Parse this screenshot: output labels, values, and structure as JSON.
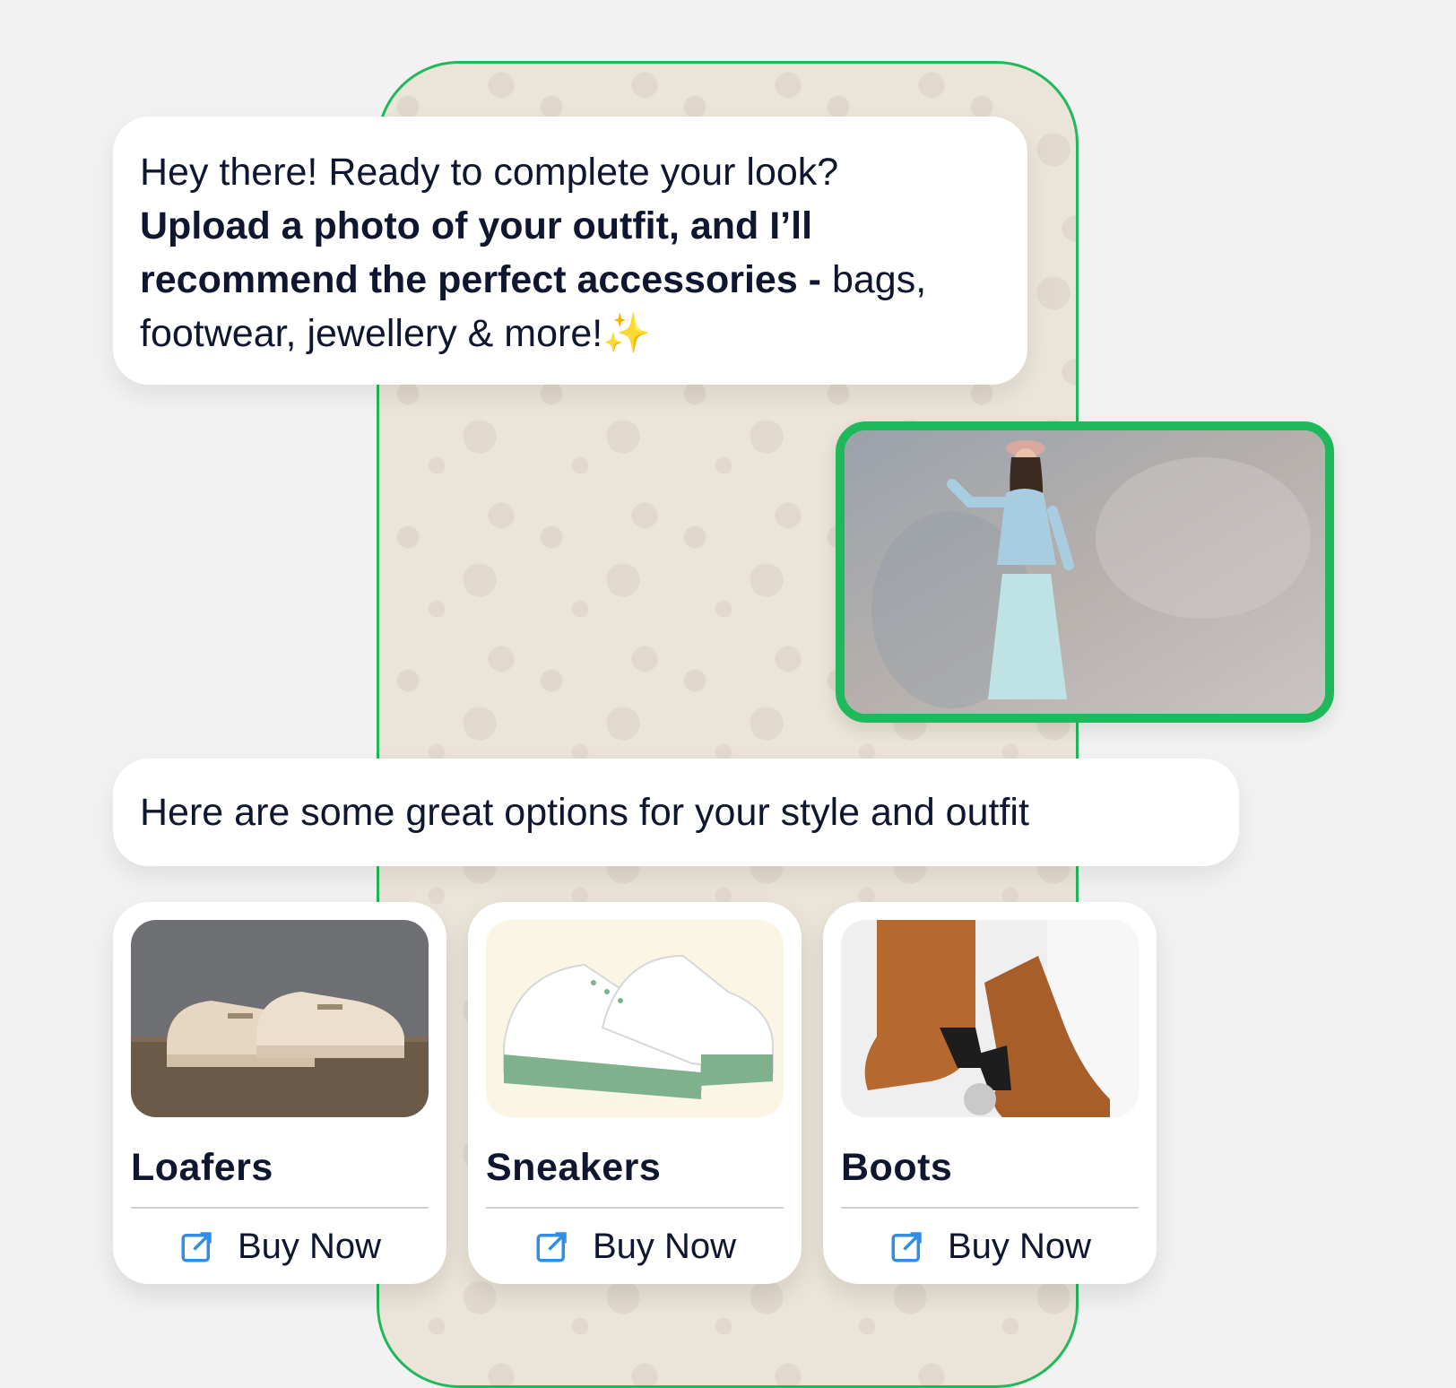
{
  "chat": {
    "intro": {
      "line1": "Hey there! Ready to complete your look?",
      "bold": "Upload a photo of your outfit, and I’ll recommend the perfect accessories -",
      "rest": " bags, footwear, jewellery & more!",
      "emoji": "✨"
    },
    "reply": "Here are some great options for your style and outfit"
  },
  "products": [
    {
      "name": "Loafers",
      "action": "Buy Now"
    },
    {
      "name": "Sneakers",
      "action": "Buy Now"
    },
    {
      "name": "Boots",
      "action": "Buy Now"
    }
  ],
  "colors": {
    "accent_green": "#1fb85a",
    "link_blue": "#2f8ee5",
    "text_dark": "#0f1730"
  }
}
